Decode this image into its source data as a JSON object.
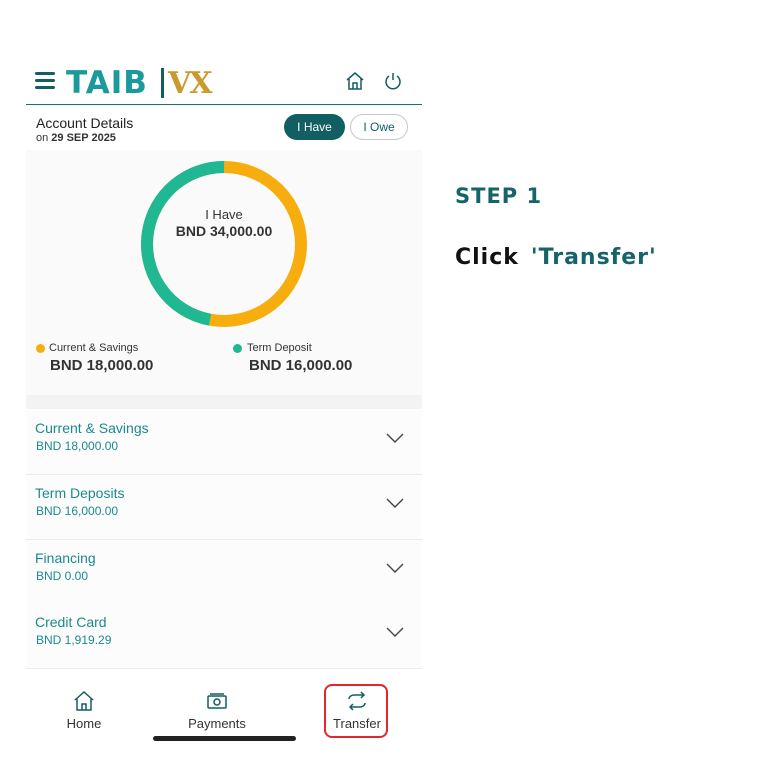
{
  "header": {
    "logo_text": "TAIB",
    "logo_mark": "VX",
    "icons": [
      "menu-icon",
      "home-icon",
      "power-icon"
    ]
  },
  "account": {
    "title": "Account Details",
    "date_prefix": "on ",
    "date": "29 SEP 2025",
    "toggle_have": "I Have",
    "toggle_owe": "I Owe"
  },
  "summary": {
    "center_label": "I Have",
    "center_value": "BND 34,000.00",
    "legend": [
      {
        "label": "Current & Savings",
        "value": "BND 18,000.00",
        "color": "#f7ad0d"
      },
      {
        "label": "Term Deposit",
        "value": "BND 16,000.00",
        "color": "#1fb893"
      }
    ],
    "share_current_savings": 0.529,
    "share_term_deposit": 0.471
  },
  "accounts": [
    {
      "title": "Current & Savings",
      "value": "BND 18,000.00"
    },
    {
      "title": "Term Deposits",
      "value": "BND 16,000.00"
    },
    {
      "title": "Financing",
      "value": "BND 0.00"
    },
    {
      "title": "Credit Card",
      "value": "BND 1,919.29"
    }
  ],
  "nav": {
    "home": "Home",
    "payments": "Payments",
    "transfer": "Transfer"
  },
  "guide": {
    "step": "STEP 1",
    "instruction": "Click",
    "target": "'Transfer'"
  },
  "colors": {
    "brand_teal": "#115e63",
    "accent_gold": "#f7ad0d",
    "accent_green": "#1fb893",
    "highlight_red": "#e0282e"
  }
}
